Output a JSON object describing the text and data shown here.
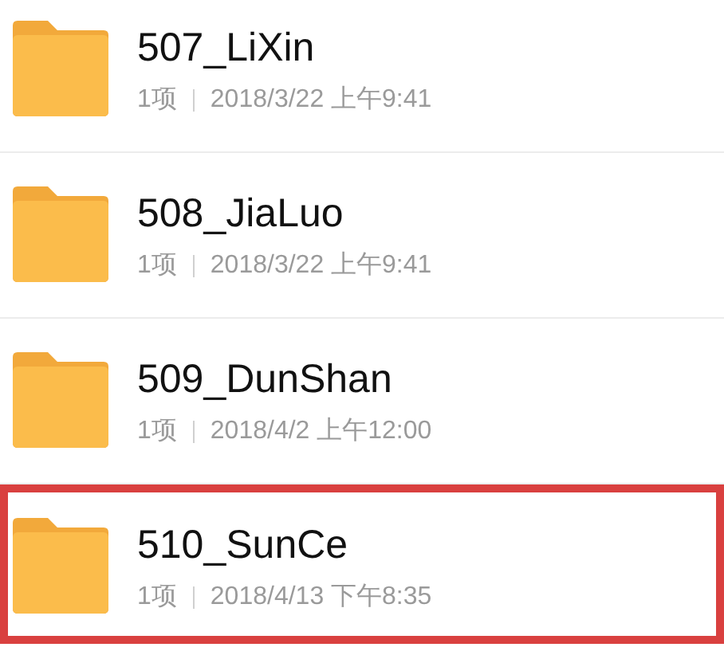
{
  "folders": [
    {
      "name": "507_LiXin",
      "count": "1项",
      "modified": "2018/3/22 上午9:41",
      "highlighted": false
    },
    {
      "name": "508_JiaLuo",
      "count": "1项",
      "modified": "2018/3/22 上午9:41",
      "highlighted": false
    },
    {
      "name": "509_DunShan",
      "count": "1项",
      "modified": "2018/4/2 上午12:00",
      "highlighted": false
    },
    {
      "name": "510_SunCe",
      "count": "1项",
      "modified": "2018/4/13 下午8:35",
      "highlighted": true
    }
  ]
}
